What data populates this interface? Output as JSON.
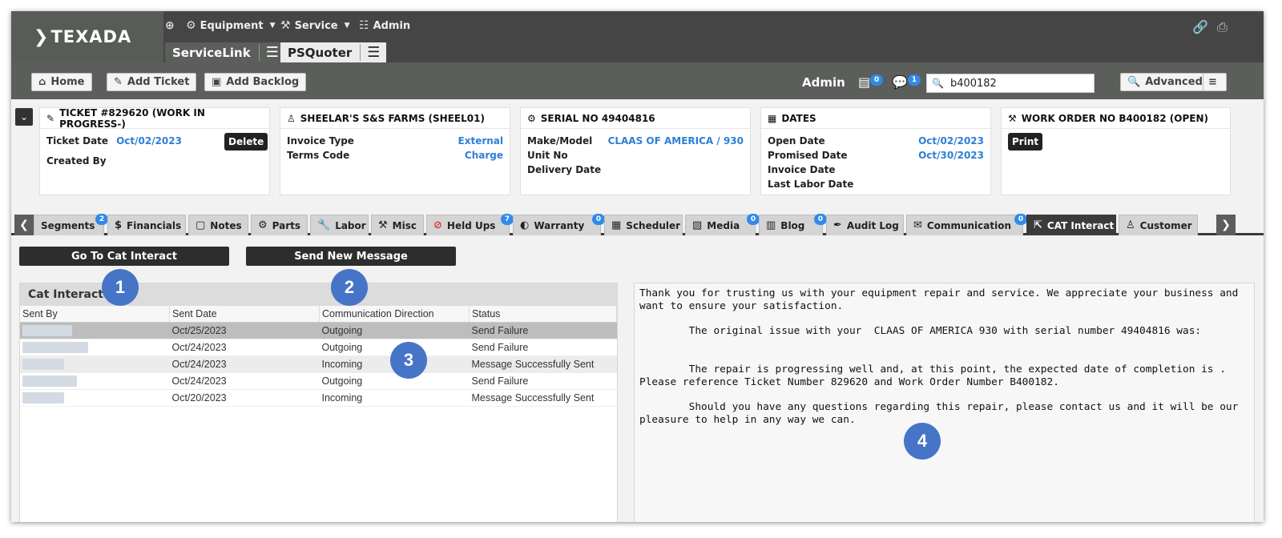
{
  "brand": {
    "logo": "TEXADA"
  },
  "top_nav": {
    "equipment": "Equipment",
    "service": "Service",
    "admin": "Admin",
    "apps": [
      "ServiceLink",
      "PSQuoter"
    ]
  },
  "toolbar": {
    "home": "Home",
    "add_ticket": "Add Ticket",
    "add_backlog": "Add Backlog",
    "user": "Admin",
    "notif_count": "0",
    "chat_count": "1",
    "search_value": "b400182",
    "advanced": "Advanced"
  },
  "cards": {
    "ticket": {
      "title": "TICKET #829620 (WORK IN PROGRESS-)",
      "ticket_date_label": "Ticket Date",
      "ticket_date": "Oct/02/2023",
      "created_by_label": "Created By",
      "delete": "Delete"
    },
    "customer": {
      "title": "SHEELAR'S S&S FARMS (SHEEL01)",
      "invoice_type_label": "Invoice Type",
      "invoice_type": "External",
      "terms_label": "Terms Code",
      "terms": "Charge"
    },
    "serial": {
      "title": "SERIAL NO 49404816",
      "make_label": "Make/Model",
      "make": "CLAAS OF AMERICA / 930",
      "unit_label": "Unit No",
      "delivery_label": "Delivery Date"
    },
    "dates": {
      "title": "DATES",
      "open_label": "Open Date",
      "open": "Oct/02/2023",
      "promised_label": "Promised Date",
      "promised": "Oct/30/2023",
      "invoice_label": "Invoice Date",
      "labor_label": "Last Labor Date"
    },
    "work_order": {
      "title": "WORK ORDER NO B400182 (OPEN)",
      "print": "Print"
    }
  },
  "tabs": [
    {
      "label": "Segments",
      "badge": "2"
    },
    {
      "label": "Financials",
      "badge": ""
    },
    {
      "label": "Notes",
      "badge": ""
    },
    {
      "label": "Parts",
      "badge": ""
    },
    {
      "label": "Labor",
      "badge": ""
    },
    {
      "label": "Misc",
      "badge": ""
    },
    {
      "label": "Held Ups",
      "badge": "7"
    },
    {
      "label": "Warranty",
      "badge": "0"
    },
    {
      "label": "Scheduler",
      "badge": ""
    },
    {
      "label": "Media",
      "badge": "0"
    },
    {
      "label": "Blog",
      "badge": "0"
    },
    {
      "label": "Audit Log",
      "badge": ""
    },
    {
      "label": "Communication",
      "badge": "0"
    },
    {
      "label": "CAT Interact",
      "badge": ""
    },
    {
      "label": "Customer",
      "badge": ""
    }
  ],
  "actions": {
    "go_to_cat": "Go To Cat Interact",
    "send_new": "Send New Message"
  },
  "cat_panel": {
    "title": "Cat Interact",
    "columns": [
      "Sent By",
      "Sent Date",
      "Communication Direction",
      "Status"
    ],
    "rows": [
      {
        "date": "Oct/25/2023",
        "direction": "Outgoing",
        "status": "Send Failure"
      },
      {
        "date": "Oct/24/2023",
        "direction": "Outgoing",
        "status": "Send Failure"
      },
      {
        "date": "Oct/24/2023",
        "direction": "Incoming",
        "status": "Message Successfully Sent"
      },
      {
        "date": "Oct/24/2023",
        "direction": "Outgoing",
        "status": "Send Failure"
      },
      {
        "date": "Oct/20/2023",
        "direction": "Incoming",
        "status": "Message Successfully Sent"
      }
    ]
  },
  "message": {
    "text": "Thank you for trusting us with your equipment repair and service. We appreciate your business and want to ensure your satisfaction.\n\n        The original issue with your  CLAAS OF AMERICA 930 with serial number 49404816 was:\n\n\n        The repair is progressing well and, at this point, the expected date of completion is .\nPlease reference Ticket Number 829620 and Work Order Number B400182.\n\n        Should you have any questions regarding this repair, please contact us and it will be our pleasure to help in any way we can."
  },
  "callouts": [
    "1",
    "2",
    "3",
    "4"
  ],
  "colors": {
    "accent_blue": "#2d7fd6",
    "badge_blue": "#2f8bea",
    "callout_blue": "#4674c6",
    "header_dark": "#454545"
  }
}
